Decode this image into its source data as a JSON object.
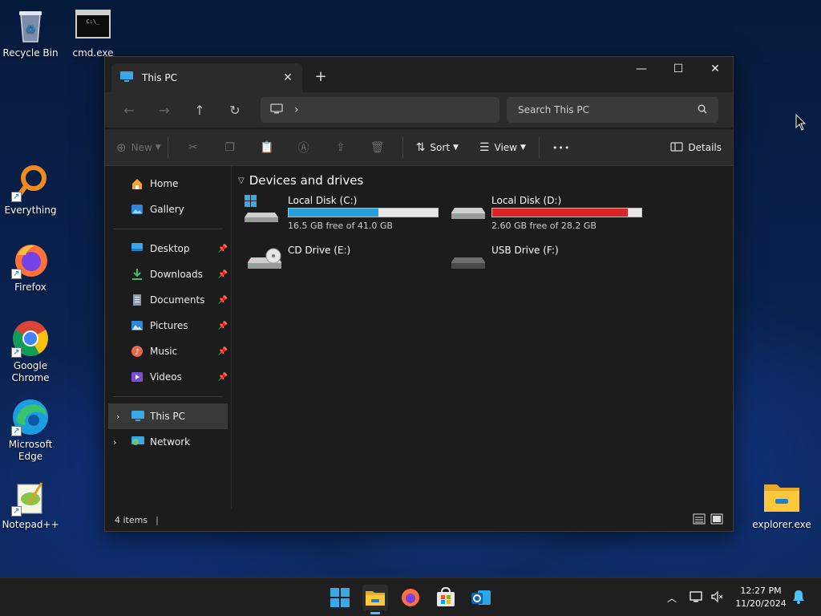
{
  "desktop": {
    "icons": {
      "recycle_bin": "Recycle Bin",
      "cmd": "cmd.exe",
      "cmd_prompt_text": "C:\\_",
      "everything": "Everything",
      "firefox": "Firefox",
      "chrome": "Google Chrome",
      "edge": "Microsoft Edge",
      "notepadpp": "Notepad++",
      "explorer": "explorer.exe"
    }
  },
  "window": {
    "tab_title": "This PC",
    "new_tab": "+",
    "nav": {
      "back": "←",
      "forward": "→",
      "up": "↑",
      "refresh": "↻",
      "breadcrumb_sep": "›"
    },
    "search": {
      "placeholder": "Search This PC"
    },
    "toolbar": {
      "new_label": "New",
      "sort_label": "Sort",
      "view_label": "View",
      "more_label": "•••",
      "details_label": "Details"
    },
    "sidebar": {
      "home": "Home",
      "gallery": "Gallery",
      "quick_access": [
        {
          "label": "Desktop",
          "icon": "desktop-folder-icon"
        },
        {
          "label": "Downloads",
          "icon": "downloads-icon"
        },
        {
          "label": "Documents",
          "icon": "documents-icon"
        },
        {
          "label": "Pictures",
          "icon": "pictures-icon"
        },
        {
          "label": "Music",
          "icon": "music-icon"
        },
        {
          "label": "Videos",
          "icon": "videos-icon"
        }
      ],
      "this_pc": "This PC",
      "network": "Network"
    },
    "content": {
      "group_title": "Devices and drives",
      "drives": [
        {
          "name": "Local Disk (C:)",
          "free_text": "16.5 GB free of 41.0 GB",
          "used_fraction": 0.6,
          "bar_color": "#26a0da"
        },
        {
          "name": "Local Disk (D:)",
          "free_text": "2.60 GB free of 28.2 GB",
          "used_fraction": 0.91,
          "bar_color": "#da2626"
        },
        {
          "name": "CD Drive (E:)"
        },
        {
          "name": "USB Drive (F:)"
        }
      ]
    },
    "status": {
      "items_text": "4 items"
    }
  },
  "taskbar": {
    "time": "12:27 PM",
    "date": "11/20/2024"
  },
  "colors": {
    "accent": "#4cc2ff",
    "window_bg": "#1c1c1c"
  }
}
